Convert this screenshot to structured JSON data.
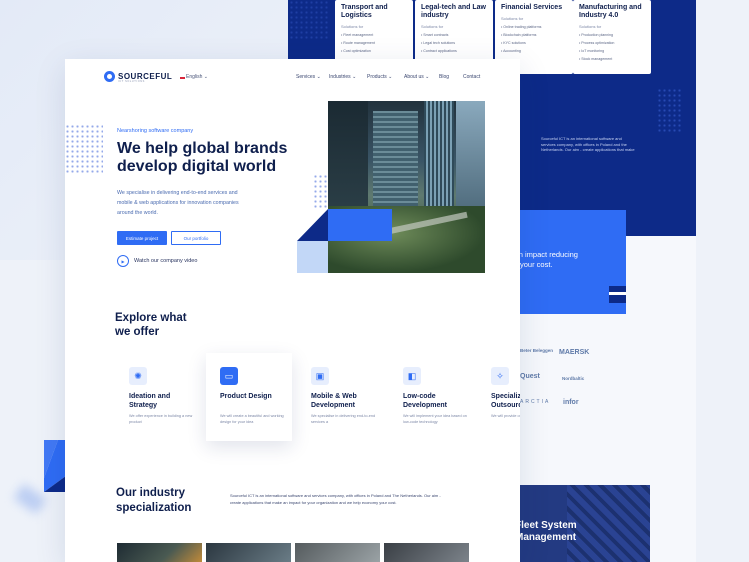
{
  "industries": [
    {
      "title": "Transport and Logistics",
      "subtitle": "Solutions for",
      "items": [
        "Fleet management",
        "Route management",
        "Cost optimization"
      ]
    },
    {
      "title": "Legal-tech and Law industry",
      "subtitle": "Solutions for",
      "items": [
        "Smart contracts",
        "Legal tech solutions",
        "Contract applications"
      ]
    },
    {
      "title": "Financial Services",
      "subtitle": "Solutions for",
      "items": [
        "Online trading platforms",
        "Blockchain platforms",
        "KYC solutions",
        "Accounting"
      ]
    },
    {
      "title": "Manufacturing and Industry 4.0",
      "subtitle": "Solutions for",
      "items": [
        "Production planning",
        "Process optimization",
        "IoT monitoring",
        "Stock management"
      ]
    }
  ],
  "back_page": {
    "about_text": "Sourceful ICT is an international software and services company, with offices in Poland and the Netherlands. Our aim - create applications that make",
    "impact_card": "Create an impact reducing your cost.",
    "logos": [
      "Beter Beleggen",
      "MAERSK",
      "Quest",
      "Nordbaltic",
      "ARCTIA",
      "infor"
    ],
    "fleet_card": "Fleet System Management"
  },
  "header": {
    "brand": "SOURCEFUL",
    "tagline": "ICT SOLUTIONS",
    "language": "English",
    "nav": [
      {
        "label": "Services",
        "has_dropdown": true
      },
      {
        "label": "Industries",
        "has_dropdown": true
      },
      {
        "label": "Products",
        "has_dropdown": true
      },
      {
        "label": "About us",
        "has_dropdown": true
      },
      {
        "label": "Blog",
        "has_dropdown": false
      },
      {
        "label": "Contact",
        "has_dropdown": false
      }
    ]
  },
  "hero": {
    "kicker": "Nearshoring software company",
    "title": "We help global brands develop digital world",
    "description": "We specialise in delivering end-to-end services and mobile & web applications for innovation companies around the world.",
    "primary_button": "Estimate project",
    "secondary_button": "Our portfolio",
    "video_link": "Watch our company video"
  },
  "offer": {
    "title": "Explore what we offer",
    "services": [
      {
        "title": "Ideation and Strategy",
        "desc": "We offer experience in building a new product",
        "icon": "lightbulb-icon",
        "active": false
      },
      {
        "title": "Product Design",
        "desc": "We will create a beautiful and working design for your idea",
        "icon": "design-icon",
        "active": true
      },
      {
        "title": "Mobile & Web Development",
        "desc": "We specialise in delivering end-to-end services a",
        "icon": "code-icon",
        "active": false
      },
      {
        "title": "Low-code Development",
        "desc": "We will implement your idea based on low-code technology",
        "icon": "lowcode-icon",
        "active": false
      },
      {
        "title": "Specialized Outsourcing",
        "desc": "We will provide our expertise",
        "icon": "outsourcing-icon",
        "active": false
      }
    ]
  },
  "specialization": {
    "title": "Our industry specialization",
    "description": "Sourceful ICT is an international software and services company, with offices in Poland and The Netherlands. Our aim - create applications that make an impact for your organization and we help economy your cost."
  },
  "colors": {
    "accent": "#2f6cf4",
    "navy": "#0d2a88",
    "text": "#0f1f4d"
  }
}
